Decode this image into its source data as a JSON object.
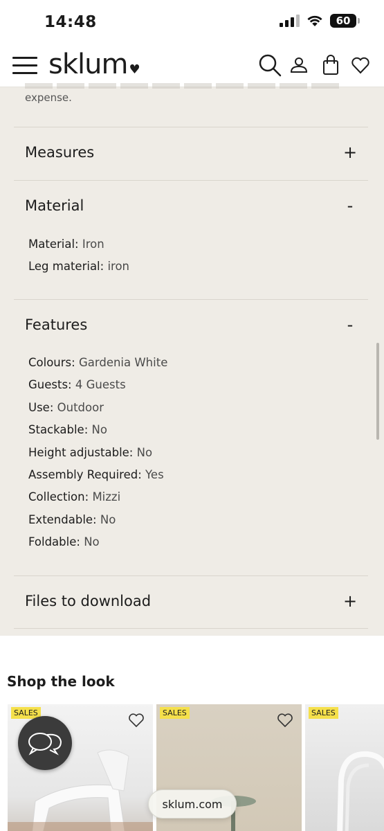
{
  "status_bar": {
    "time": "14:48",
    "battery": "60"
  },
  "header": {
    "logo": "sklum"
  },
  "intro": {
    "text": "expense."
  },
  "sections": {
    "measures": {
      "title": "Measures",
      "toggle": "+"
    },
    "material": {
      "title": "Material",
      "toggle": "-",
      "rows": [
        {
          "key": "Material:",
          "value": "Iron"
        },
        {
          "key": "Leg material:",
          "value": "iron"
        }
      ]
    },
    "features": {
      "title": "Features",
      "toggle": "-",
      "rows": [
        {
          "key": "Colours:",
          "value": " Gardenia White"
        },
        {
          "key": "Guests:",
          "value": "4 Guests"
        },
        {
          "key": "Use:",
          "value": "Outdoor"
        },
        {
          "key": "Stackable:",
          "value": "No"
        },
        {
          "key": "Height adjustable:",
          "value": "No"
        },
        {
          "key": "Assembly Required:",
          "value": "Yes"
        },
        {
          "key": "Collection:",
          "value": "Mizzi"
        },
        {
          "key": "Extendable:",
          "value": "No"
        },
        {
          "key": "Foldable:",
          "value": "No"
        }
      ]
    },
    "files": {
      "title": "Files to download",
      "toggle": "+"
    }
  },
  "shop_the_look": {
    "title": "Shop the look",
    "cards": [
      {
        "badge": "SALES"
      },
      {
        "badge": "SALES"
      },
      {
        "badge": "SALES"
      }
    ]
  },
  "browser": {
    "url": "sklum.com"
  },
  "icons": {
    "menu": "hamburger-menu-icon",
    "search": "search-icon",
    "account": "user-icon",
    "cart": "shopping-bag-icon",
    "wishlist": "heart-icon",
    "chat": "chat-bubbles-icon"
  },
  "colors": {
    "panel": "#efece6",
    "badge": "#f5e04b",
    "fab": "#3b3b3b"
  }
}
